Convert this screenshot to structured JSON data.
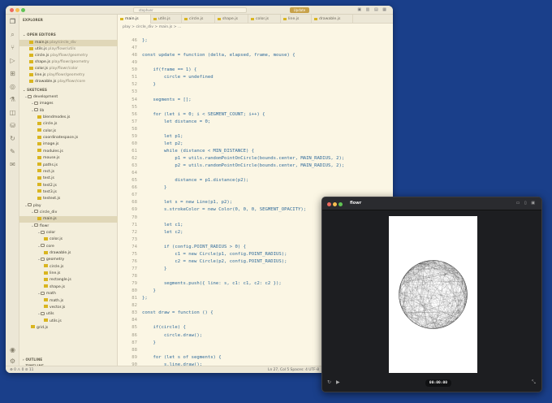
{
  "vscode": {
    "search_text": "stephver",
    "update_label": "Update",
    "tabs": [
      "main.js",
      "utils.js",
      "circle.js",
      "shape.js",
      "color.js",
      "line.js",
      "drawable.js"
    ],
    "breadcrumb": "play > circle_div > main.js > ...",
    "sidebar": {
      "explorer_title": "EXPLORER",
      "open_editors_title": "OPEN EDITORS",
      "open_editors": [
        {
          "name": "main.js",
          "path": "play/circle_div"
        },
        {
          "name": "utils.js",
          "path": "play/flowr/utils"
        },
        {
          "name": "circle.js",
          "path": "play/flowr/geometry"
        },
        {
          "name": "shape.js",
          "path": "play/flowr/geometry"
        },
        {
          "name": "color.js",
          "path": "play/flowr/color"
        },
        {
          "name": "line.js",
          "path": "play/flowr/geometry"
        },
        {
          "name": "drawable.js",
          "path": "play/flowr/core"
        }
      ],
      "sketches_title": "SKETCHES",
      "tree": [
        {
          "label": "development",
          "type": "dir",
          "depth": 0
        },
        {
          "label": "images",
          "type": "dir",
          "depth": 1
        },
        {
          "label": "lib",
          "type": "dir",
          "depth": 1
        },
        {
          "label": "blendmodes.js",
          "type": "file",
          "depth": 2
        },
        {
          "label": "circle.js",
          "type": "file",
          "depth": 2
        },
        {
          "label": "color.js",
          "type": "file",
          "depth": 2
        },
        {
          "label": "coordinatespace.js",
          "type": "file",
          "depth": 2
        },
        {
          "label": "image.js",
          "type": "file",
          "depth": 2
        },
        {
          "label": "modules.js",
          "type": "file",
          "depth": 2
        },
        {
          "label": "mouse.js",
          "type": "file",
          "depth": 2
        },
        {
          "label": "paths.js",
          "type": "file",
          "depth": 2
        },
        {
          "label": "rect.js",
          "type": "file",
          "depth": 2
        },
        {
          "label": "test.js",
          "type": "file",
          "depth": 2
        },
        {
          "label": "test2.js",
          "type": "file",
          "depth": 2
        },
        {
          "label": "test3.js",
          "type": "file",
          "depth": 2
        },
        {
          "label": "testext.js",
          "type": "file",
          "depth": 2
        },
        {
          "label": "play",
          "type": "dir",
          "depth": 0
        },
        {
          "label": "circle_div",
          "type": "dir",
          "depth": 1
        },
        {
          "label": "main.js",
          "type": "file",
          "depth": 2,
          "selected": true
        },
        {
          "label": "flowr",
          "type": "dir",
          "depth": 1
        },
        {
          "label": "color",
          "type": "dir",
          "depth": 2
        },
        {
          "label": "color.js",
          "type": "file",
          "depth": 3
        },
        {
          "label": "core",
          "type": "dir",
          "depth": 2
        },
        {
          "label": "drawable.js",
          "type": "file",
          "depth": 3
        },
        {
          "label": "geometry",
          "type": "dir",
          "depth": 2
        },
        {
          "label": "circle.js",
          "type": "file",
          "depth": 3
        },
        {
          "label": "line.js",
          "type": "file",
          "depth": 3
        },
        {
          "label": "rectangle.js",
          "type": "file",
          "depth": 3
        },
        {
          "label": "shape.js",
          "type": "file",
          "depth": 3
        },
        {
          "label": "math",
          "type": "dir",
          "depth": 2
        },
        {
          "label": "math.js",
          "type": "file",
          "depth": 3
        },
        {
          "label": "vector.js",
          "type": "file",
          "depth": 3
        },
        {
          "label": "utils",
          "type": "dir",
          "depth": 2
        },
        {
          "label": "utils.js",
          "type": "file",
          "depth": 3
        },
        {
          "label": "grid.js",
          "type": "file",
          "depth": 1
        }
      ],
      "outline_title": "OUTLINE",
      "timeline_title": "TIMELINE"
    },
    "code": {
      "line_numbers": [
        46,
        47,
        48,
        49,
        50,
        51,
        52,
        53,
        54,
        55,
        56,
        57,
        58,
        59,
        60,
        61,
        62,
        63,
        64,
        65,
        66,
        67,
        68,
        69,
        70,
        71,
        72,
        73,
        74,
        75,
        76,
        77,
        78,
        79,
        80,
        81,
        82,
        83,
        84,
        85,
        86,
        87,
        88,
        89,
        90
      ],
      "lines": [
        "};",
        "",
        "const update = function (delta, elapsed, frame, mouse) {",
        "",
        "    if(frame == 1) {",
        "        circle = undefined",
        "    }",
        "",
        "    segments = [];",
        "",
        "    for (let i = 0; i < SEGMENT_COUNT; i++) {",
        "        let distance = 0;",
        "",
        "        let p1;",
        "        let p2;",
        "        while (distance < MIN_DISTANCE) {",
        "            p1 = utils.randomPointOnCircle(bounds.center, MAIN_RADIUS, 2);",
        "            p2 = utils.randomPointOnCircle(bounds.center, MAIN_RADIUS, 2);",
        "",
        "            distance = p1.distance(p2);",
        "        }",
        "",
        "        let s = new Line(p1, p2);",
        "        s.strokeColor = new Color(0, 0, 0, SEGMENT_OPACITY);",
        "",
        "        let c1;",
        "        let c2;",
        "",
        "        if (config.POINT_RADIUS > 0) {",
        "            c1 = new Circle(p1, config.POINT_RADIUS);",
        "            c2 = new Circle(p2, config.POINT_RADIUS);",
        "        }",
        "",
        "        segments.push({ line: s, c1: c1, c2: c2 });",
        "    }",
        "};",
        "",
        "const draw = function () {",
        "",
        "    if(circle) {",
        "        circle.draw();",
        "    }",
        "",
        "    for (let s of segments) {",
        "        s.line.draw();"
      ]
    },
    "status": {
      "left": "⊗ 0 ⚠ 0   ⊘ 11",
      "right": "Ln 27, Col 5   Spaces: 4   UTF-8"
    }
  },
  "flowr": {
    "title": "flowr",
    "timer": "00:00:00"
  }
}
